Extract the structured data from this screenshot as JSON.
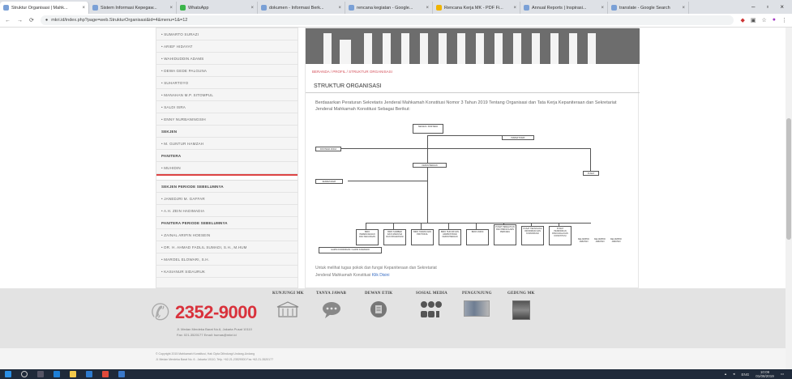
{
  "browser": {
    "tabs": [
      {
        "title": "Struktur Organisasi | Mahk..."
      },
      {
        "title": "Sistem Informasi Kepegaw..."
      },
      {
        "title": "WhatsApp"
      },
      {
        "title": "dokumen - Informasi Berk..."
      },
      {
        "title": "rencana kegiatan - Google..."
      },
      {
        "title": "Rencana Kerja MK - PDF Fi..."
      },
      {
        "title": "Annual Reports | Inspirasi..."
      },
      {
        "title": "translate - Google Search"
      }
    ],
    "url": "mkri.id/index.php?page=web.StrukturOrganisasi&id=4&menu=1&=12"
  },
  "sidebar": {
    "items": [
      {
        "label": "• SUMARTO SURAZI",
        "type": "item"
      },
      {
        "label": "• ARIEF HIDAYAT",
        "type": "item"
      },
      {
        "label": "• WAHIDUDDIN ADAMS",
        "type": "item"
      },
      {
        "label": "• DEWA GEDE PALGUNA",
        "type": "item"
      },
      {
        "label": "• SUHARTOYO",
        "type": "item"
      },
      {
        "label": "• MANAHAN M.P. SITOMPUL",
        "type": "item"
      },
      {
        "label": "• SALDI ISRA",
        "type": "item"
      },
      {
        "label": "• ENNY NURBANINGSIH",
        "type": "item"
      },
      {
        "label": "SEKJEN",
        "type": "head"
      },
      {
        "label": "• M. GUNTUR HAMZAH",
        "type": "item"
      },
      {
        "label": "PANITERA",
        "type": "head"
      },
      {
        "label": "• MUHIDIN",
        "type": "item"
      }
    ],
    "past_items": [
      {
        "label": "SEKJEN PERIODE SEBELUMNYA",
        "type": "head"
      },
      {
        "label": "• JANEDJRI M. GAFFAR",
        "type": "item"
      },
      {
        "label": "• A.H. ZEIN HADIMADIA",
        "type": "item"
      },
      {
        "label": "PANITERA PERIODE SEBELUMNYA",
        "type": "head"
      },
      {
        "label": "• ZAINAL ARIFIN HOESEIN",
        "type": "item"
      },
      {
        "label": "• DR. H. AHMAD FADLIL SUMADI, S.H., M.HUM",
        "type": "item"
      },
      {
        "label": "• MAROEL ELOWARI, S.H.",
        "type": "item"
      },
      {
        "label": "• KASIANUR SIDAURUK",
        "type": "item"
      }
    ]
  },
  "content": {
    "breadcrumb": "BERANDA / PROFIL / STRUKTUR ORGANISASI",
    "title": "STRUKTUR ORGANISASI",
    "intro": "Berdasarkan Peraturan Sekretaris Jenderal Mahkamah Konstitusi Nomor 3 Tahun 2019 Tentang Organisasi dan Tata Kerja Kepaniteraan dan Sekretariat Jenderal Mahkamah Konstitusi Sebagai Berikut:",
    "outro_line1": "Untuk melihat tugas pokok dan fungsi Kepaniteraan dan Sekretariat",
    "outro_line2": "Jenderal Mahkamah Konstitusi",
    "outro_link": "Klik Disini"
  },
  "org_chart": {
    "top": "SEKJEN / PANITERA",
    "right_top": "INSPEKTORAT",
    "left1": "PANITERA MUDA",
    "mid": "KEPANITERAAN",
    "right2": "PUSAT",
    "left3": "SEKRETARIAT",
    "bottom": [
      "BIRO PERENCANAAN DAN KEUANGAN",
      "BIRO SUMBER DAYA MANUSIA DAN ORGANISASI",
      "BIRO HUMAS DAN PROTOKOL",
      "BIRO HUKUM DAN ADMINISTRASI KEPANITERAAN",
      "BIRO UMUM",
      "PUSAT PENELITIAN DAN PENGKAJIAN PERKARA",
      "PUSAT TEKNOLOGI INFORMASI DAN KOMUNIKASI",
      "PUSAT PENDIDIKAN PANCASILA DAN KONSTITUSI"
    ],
    "right_small": [
      "KELOMPOK JABATAN",
      "KELOMPOK JABATAN",
      "KELOMPOK JABATAN"
    ],
    "legend": "GARIS KOORDINASI / GARIS KOMANDO"
  },
  "footer": {
    "phone": "2352-9000",
    "address_line1": "Jl. Medan Merdeka Barat No.6, Jakarta Pusat 10110",
    "address_line2": "Fax: 021-3520177  Email: humas@mkri.id",
    "sections": [
      {
        "title": "KUNJUNGI MK",
        "icon": "building-icon"
      },
      {
        "title": "TANYA JAWAB",
        "icon": "chat-icon"
      },
      {
        "title": "DEWAN ETIK",
        "icon": "document-icon"
      },
      {
        "title": "SOSIAL MEDIA",
        "icon": "social-icon"
      },
      {
        "title": "PENGUNJUNG",
        "icon": "visitors-icon"
      },
      {
        "title": "GEDUNG MK",
        "icon": "building-photo-icon"
      }
    ],
    "copyright1": "© Copyright 2015 Mahkamah Konstitusi, Hak Cipta Dilindungi Undang-Undang",
    "copyright2": "Jl. Medan Merdeka Barat No. 6 - Jakarta 10110, Telp. +62-21-23529000 Fax.+62-21-3520177"
  },
  "taskbar": {
    "time": "10:09",
    "date": "01/08/2019",
    "lang": "ENG"
  },
  "colors": {
    "accent": "#d9323c",
    "link": "#3a6ec4",
    "footer_bg": "#e3e3e3"
  }
}
